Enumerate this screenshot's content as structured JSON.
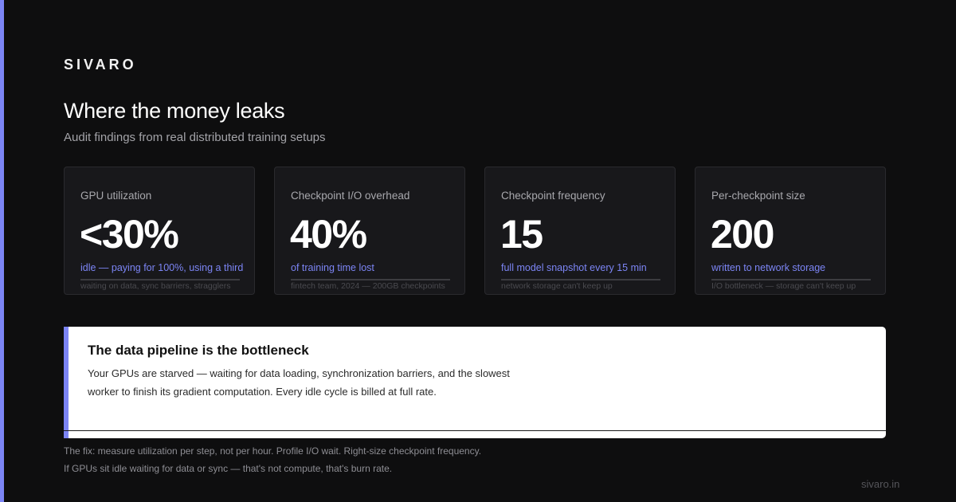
{
  "brand": "SIVARO",
  "title": "Where the money leaks",
  "subtitle": "Audit findings from real distributed training setups",
  "cards": [
    {
      "label": "GPU utilization",
      "value": "<30%",
      "caption": "idle — paying for 100%, using a third",
      "note": "waiting on data, sync barriers, stragglers"
    },
    {
      "label": "Checkpoint I/O overhead",
      "value": "40%",
      "caption": "of training time lost",
      "note": "fintech team, 2024 — 200GB checkpoints"
    },
    {
      "label": "Checkpoint frequency",
      "value": "15",
      "caption": "full model snapshot every 15 min",
      "note": "network storage can't keep up"
    },
    {
      "label": "Per-checkpoint size",
      "value": "200",
      "caption": "written to network storage",
      "note": "I/O bottleneck — storage can't keep up"
    }
  ],
  "callout": {
    "title": "The data pipeline is the bottleneck",
    "body": "Your GPUs are starved — waiting for data loading, synchronization barriers, and the slowest worker to finish its gradient computation. Every idle cycle is billed at full rate."
  },
  "fix_lines": [
    "The fix: measure utilization per step, not per hour. Profile I/O wait. Right-size checkpoint frequency.",
    "If GPUs sit idle waiting for data or sync — that's not compute, that's burn rate."
  ],
  "footer_url": "sivaro.in",
  "colors": {
    "background": "#0e0e0f",
    "accent": "#7c85f5",
    "card": "#18181b",
    "callout": "#ffffff"
  }
}
